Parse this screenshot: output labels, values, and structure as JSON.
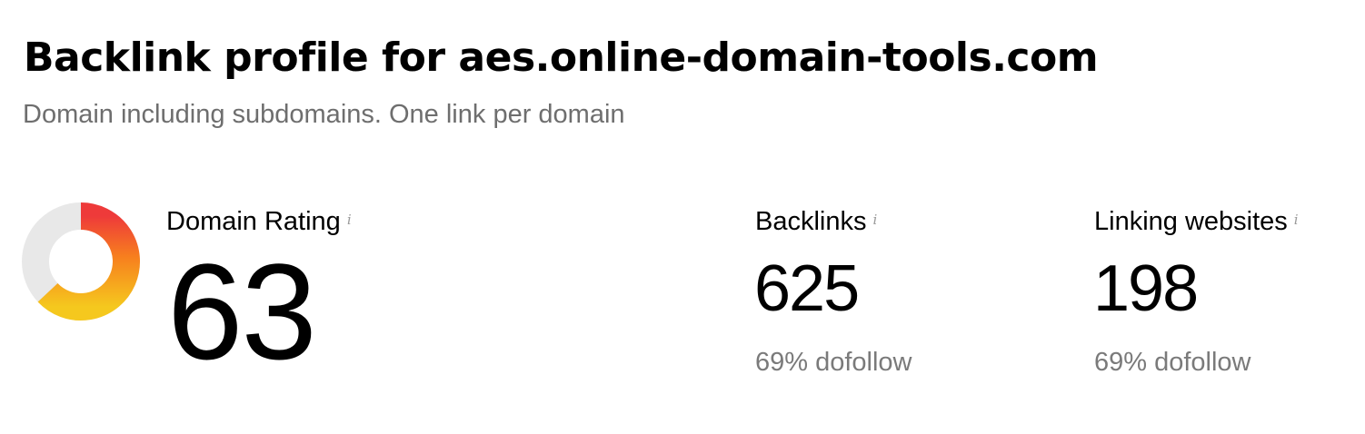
{
  "header": {
    "title": "Backlink profile for aes.online-domain-tools.com",
    "subtitle": "Domain including subdomains. One link per domain"
  },
  "metrics": {
    "domain_rating": {
      "label": "Domain Rating",
      "info_icon": "i",
      "value": "63",
      "gauge_fraction": 0.63,
      "gauge_colors": [
        "#ee3a3a",
        "#f77f1e",
        "#f5c81e"
      ],
      "gauge_track_color": "#e8e8e8"
    },
    "backlinks": {
      "label": "Backlinks",
      "info_icon": "i",
      "value": "625",
      "sub": "69% dofollow"
    },
    "linking_websites": {
      "label": "Linking websites",
      "info_icon": "i",
      "value": "198",
      "sub": "69% dofollow"
    }
  }
}
